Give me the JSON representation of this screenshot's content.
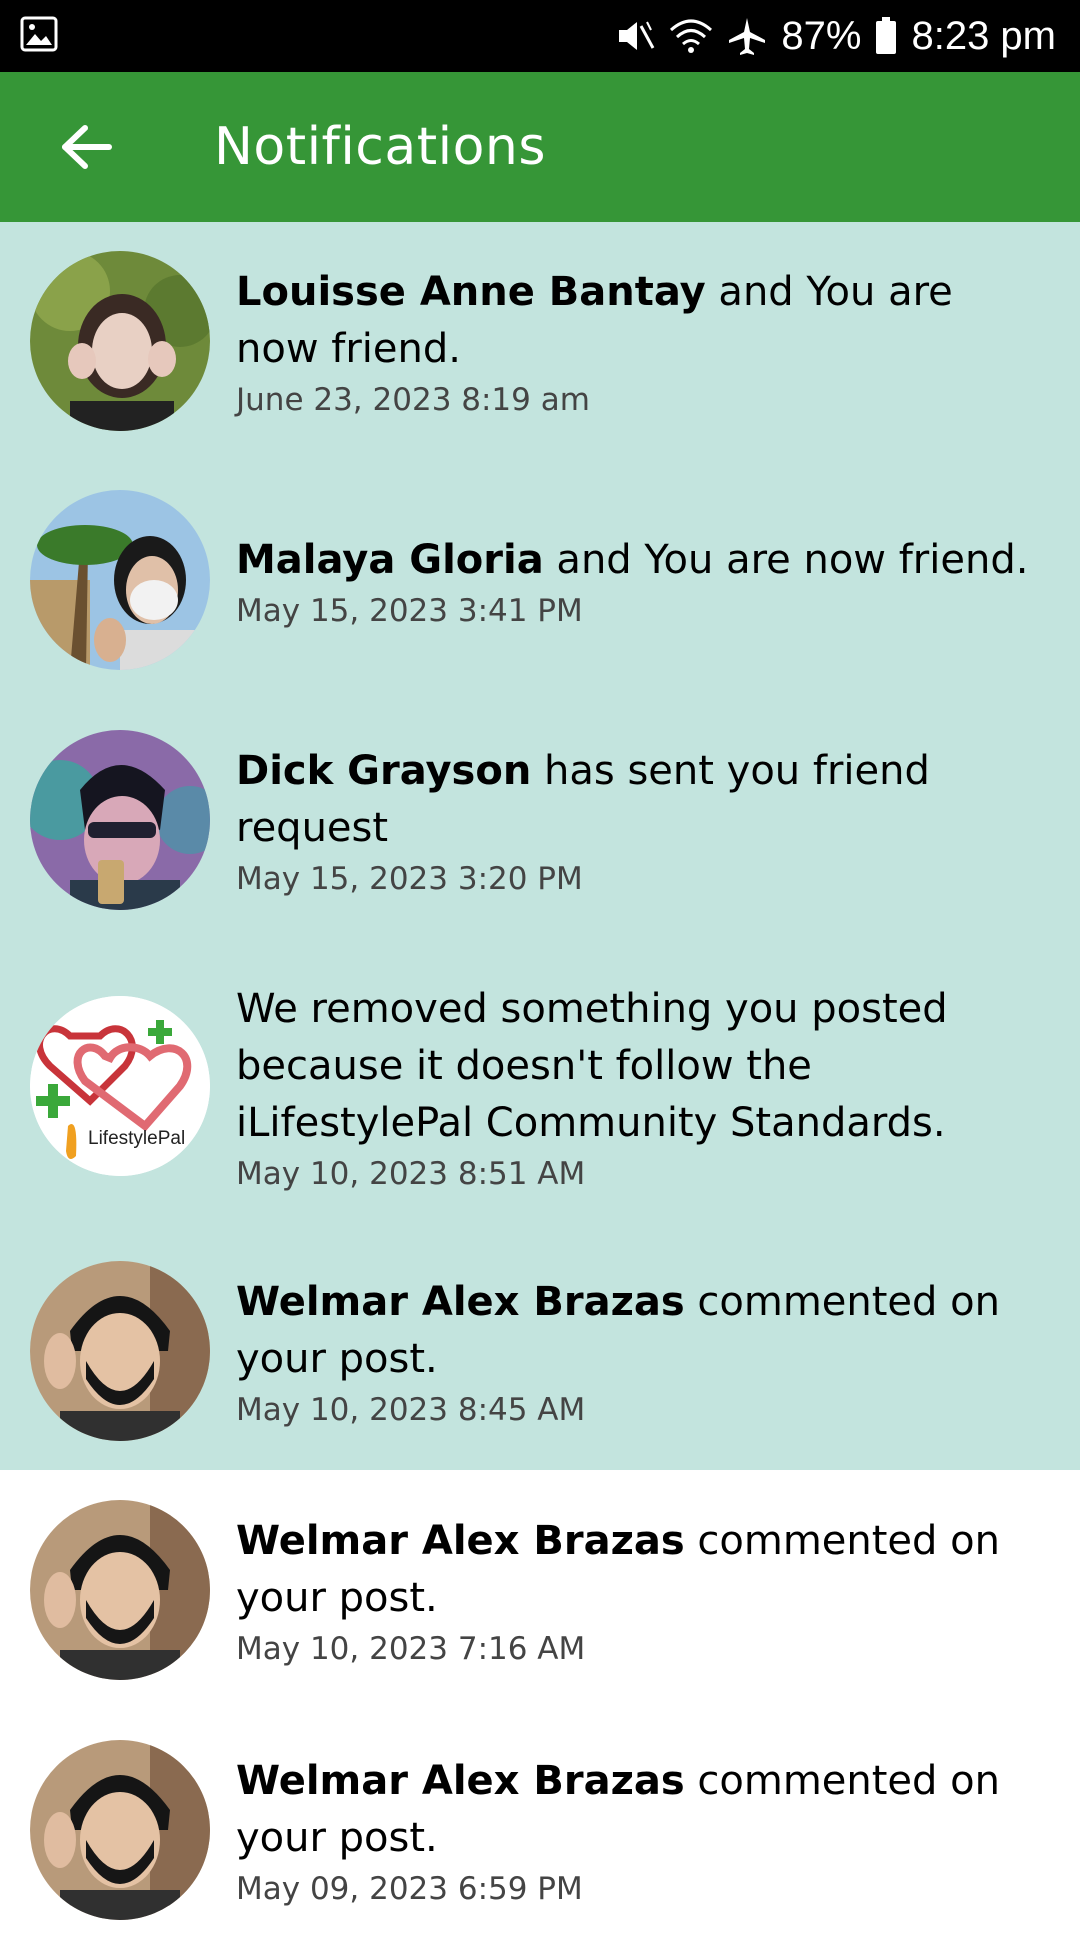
{
  "status_bar": {
    "battery": "87%",
    "time": "8:23 pm"
  },
  "app_bar": {
    "title": "Notifications"
  },
  "notifications": [
    {
      "name": "Louisse Anne Bantay",
      "message": " and You are now friend.",
      "time": "June 23, 2023 8:19 am",
      "unread": true
    },
    {
      "name": "Malaya Gloria",
      "message": " and You are now friend.",
      "time": "May 15, 2023 3:41 PM",
      "unread": true
    },
    {
      "name": "Dick Grayson",
      "message": " has sent you friend request",
      "time": "May 15, 2023 3:20 PM",
      "unread": true
    },
    {
      "name": "",
      "message": "We removed something you posted because it doesn't follow the iLifestylePal Community Standards.",
      "time": "May 10, 2023 8:51 AM",
      "unread": true,
      "logo_text": "LifestylePal"
    },
    {
      "name": "Welmar Alex Brazas",
      "message": " commented on your post.",
      "time": "May 10, 2023 8:45 AM",
      "unread": true
    },
    {
      "name": "Welmar Alex Brazas",
      "message": " commented on your post.",
      "time": "May 10, 2023 7:16 AM",
      "unread": false
    },
    {
      "name": "Welmar Alex Brazas",
      "message": " commented on your post.",
      "time": "May 09, 2023 6:59 PM",
      "unread": false
    }
  ],
  "colors": {
    "app_bar": "#369637",
    "unread_bg": "#c3e4de",
    "read_bg": "#ffffff"
  }
}
